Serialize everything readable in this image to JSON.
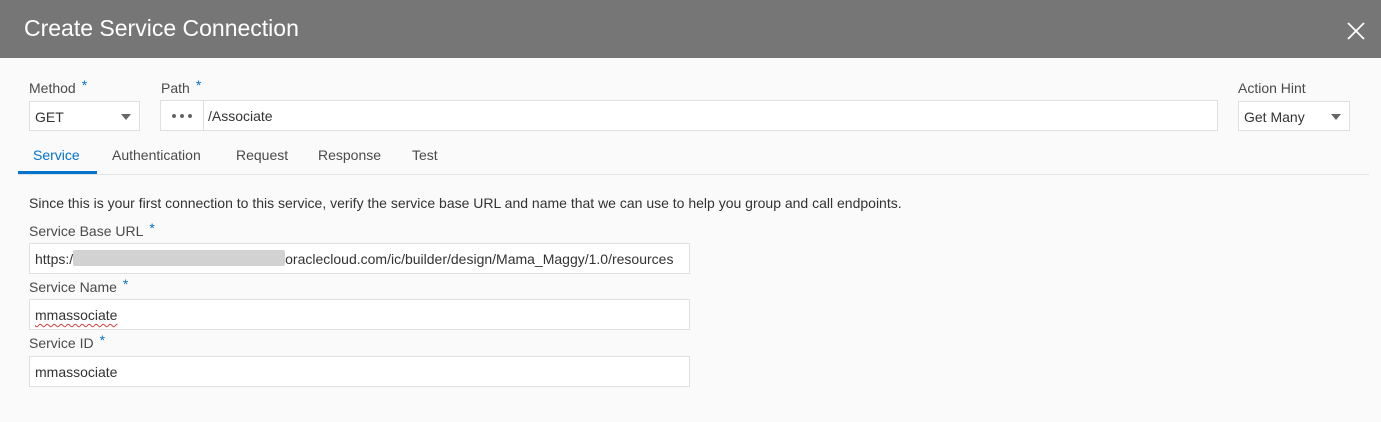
{
  "dialog": {
    "title": "Create Service Connection",
    "close_icon": "close-icon"
  },
  "method": {
    "label": "Method",
    "required_mark": "*",
    "value": "GET"
  },
  "path": {
    "label": "Path",
    "required_mark": "*",
    "browse_icon": "ellipsis-icon",
    "value": "/Associate"
  },
  "action_hint": {
    "label": "Action Hint",
    "value": "Get Many"
  },
  "tabs": [
    {
      "label": "Service",
      "active": true
    },
    {
      "label": "Authentication",
      "active": false
    },
    {
      "label": "Request",
      "active": false
    },
    {
      "label": "Response",
      "active": false
    },
    {
      "label": "Test",
      "active": false
    }
  ],
  "service": {
    "info_text": "Since this is your first connection to this service, verify the service base URL and name that we can use to help you group and call endpoints.",
    "base_url": {
      "label": "Service Base URL",
      "required_mark": "*",
      "value_prefix": "https:/",
      "value_suffix": "oraclecloud.com/ic/builder/design/Mama_Maggy/1.0/resources"
    },
    "name": {
      "label": "Service Name",
      "required_mark": "*",
      "value": "mmassociate"
    },
    "id": {
      "label": "Service ID",
      "required_mark": "*",
      "value": "mmassociate"
    }
  },
  "colors": {
    "titlebar": "#767676",
    "accent": "#0572ce",
    "background": "#fafafa"
  }
}
